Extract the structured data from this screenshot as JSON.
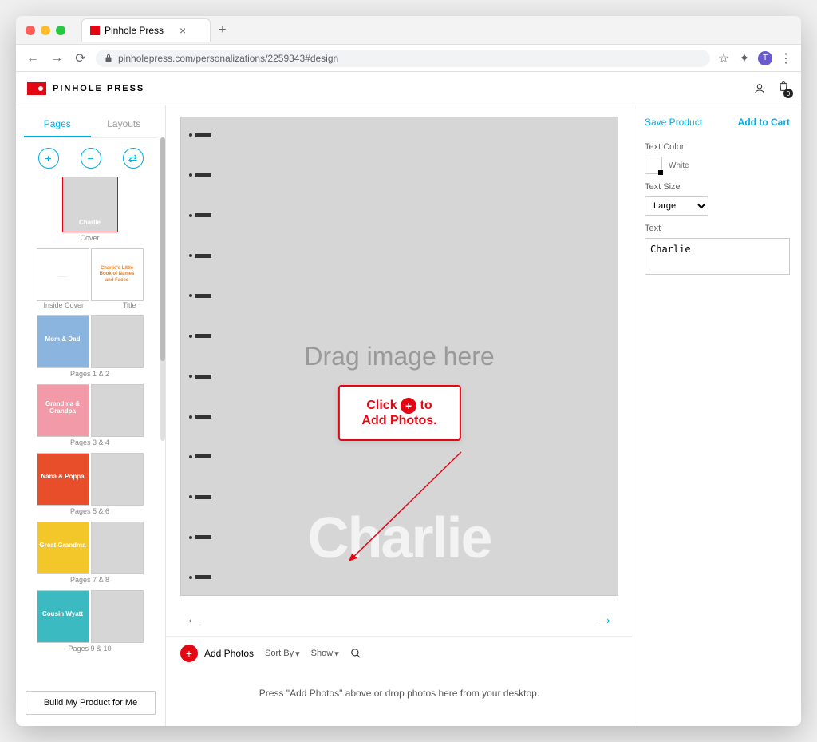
{
  "browser": {
    "tab_title": "Pinhole Press",
    "url": "pinholepress.com/personalizations/2259343#design",
    "profile_initial": "T"
  },
  "header": {
    "brand": "PINHOLE PRESS",
    "cart_count": "0"
  },
  "sidebar": {
    "tab_pages": "Pages",
    "tab_layouts": "Layouts",
    "thumbs": {
      "cover": {
        "label": "Charlie",
        "caption": "Cover"
      },
      "spread1": {
        "left_caption": "Inside Cover",
        "right_caption": "Title",
        "title_line1": "Charlie's Little",
        "title_line2": "Book of Names",
        "title_line3": "and Faces"
      },
      "spread2": {
        "label": "Mom & Dad",
        "caption": "Pages 1 & 2"
      },
      "spread3": {
        "label": "Grandma & Grandpa",
        "caption": "Pages 3 & 4"
      },
      "spread4": {
        "label": "Nana & Poppa",
        "caption": "Pages 5 & 6"
      },
      "spread5": {
        "label": "Great Grandma",
        "caption": "Pages 7 & 8"
      },
      "spread6": {
        "label": "Cousin Wyatt",
        "caption": "Pages 9 & 10"
      }
    },
    "build_btn": "Build My Product for Me"
  },
  "canvas": {
    "drop_text": "Drag image here",
    "name_overlay": "Charlie"
  },
  "tooltip": {
    "line1_a": "Click",
    "line1_b": "to",
    "line2": "Add Photos."
  },
  "photobar": {
    "add": "Add Photos",
    "sort": "Sort By",
    "show": "Show",
    "dropmsg": "Press \"Add Photos\" above or drop photos here from your desktop."
  },
  "rightpanel": {
    "save": "Save Product",
    "cart": "Add to Cart",
    "textcolor_label": "Text Color",
    "textcolor_value": "White",
    "textsize_label": "Text Size",
    "textsize_value": "Large",
    "text_label": "Text",
    "text_value": "Charlie"
  }
}
